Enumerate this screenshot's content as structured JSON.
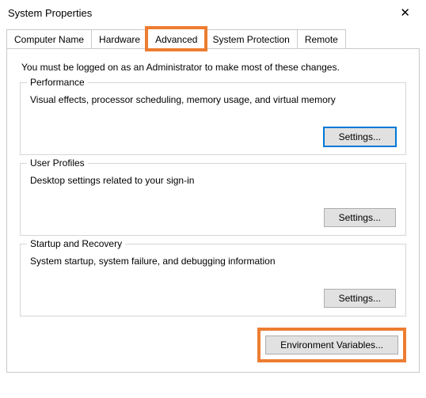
{
  "window": {
    "title": "System Properties"
  },
  "tabs": [
    {
      "label": "Computer Name"
    },
    {
      "label": "Hardware"
    },
    {
      "label": "Advanced"
    },
    {
      "label": "System Protection"
    },
    {
      "label": "Remote"
    }
  ],
  "activeTab": "Advanced",
  "intro": "You must be logged on as an Administrator to make most of these changes.",
  "groups": {
    "performance": {
      "title": "Performance",
      "desc": "Visual effects, processor scheduling, memory usage, and virtual memory",
      "button": "Settings..."
    },
    "userProfiles": {
      "title": "User Profiles",
      "desc": "Desktop settings related to your sign-in",
      "button": "Settings..."
    },
    "startupRecovery": {
      "title": "Startup and Recovery",
      "desc": "System startup, system failure, and debugging information",
      "button": "Settings..."
    }
  },
  "envVarButton": "Environment Variables..."
}
